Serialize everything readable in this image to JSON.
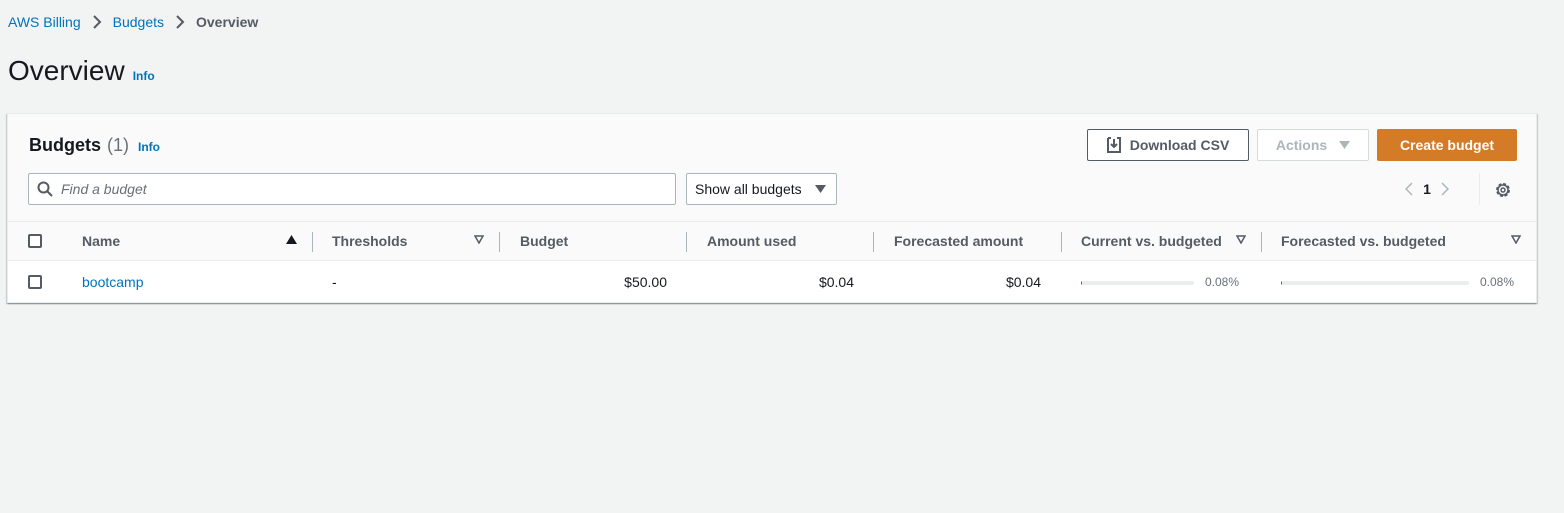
{
  "breadcrumb": {
    "items": [
      {
        "label": "AWS Billing"
      },
      {
        "label": "Budgets"
      },
      {
        "label": "Overview"
      }
    ]
  },
  "page": {
    "title": "Overview",
    "info": "Info"
  },
  "panel": {
    "title": "Budgets",
    "count": "(1)",
    "info": "Info",
    "download_label": "Download CSV",
    "actions_label": "Actions",
    "create_label": "Create budget",
    "search_placeholder": "Find a budget",
    "filter_selected": "Show all budgets",
    "page_number": "1"
  },
  "table": {
    "columns": {
      "name": "Name",
      "thresholds": "Thresholds",
      "budget": "Budget",
      "amount_used": "Amount used",
      "forecasted_amount": "Forecasted amount",
      "current_vs_budgeted": "Current vs. budgeted",
      "forecasted_vs_budgeted": "Forecasted vs. budgeted"
    },
    "rows": [
      {
        "name": "bootcamp",
        "thresholds": "-",
        "budget": "$50.00",
        "amount_used": "$0.04",
        "forecasted_amount": "$0.04",
        "current_vs_budgeted": "0.08%",
        "current_vs_budgeted_value": 0.0008,
        "forecasted_vs_budgeted": "0.08%",
        "forecasted_vs_budgeted_value": 0.0008
      }
    ]
  },
  "colors": {
    "link": "#0073bb",
    "primary_button": "#d47b28",
    "background": "#f2f3f3"
  },
  "icons": [
    "chevron-right-icon",
    "search-icon",
    "download-icon",
    "caret-down-icon",
    "chevron-left-icon",
    "gear-icon",
    "sort-ascending-icon",
    "sort-icon"
  ]
}
